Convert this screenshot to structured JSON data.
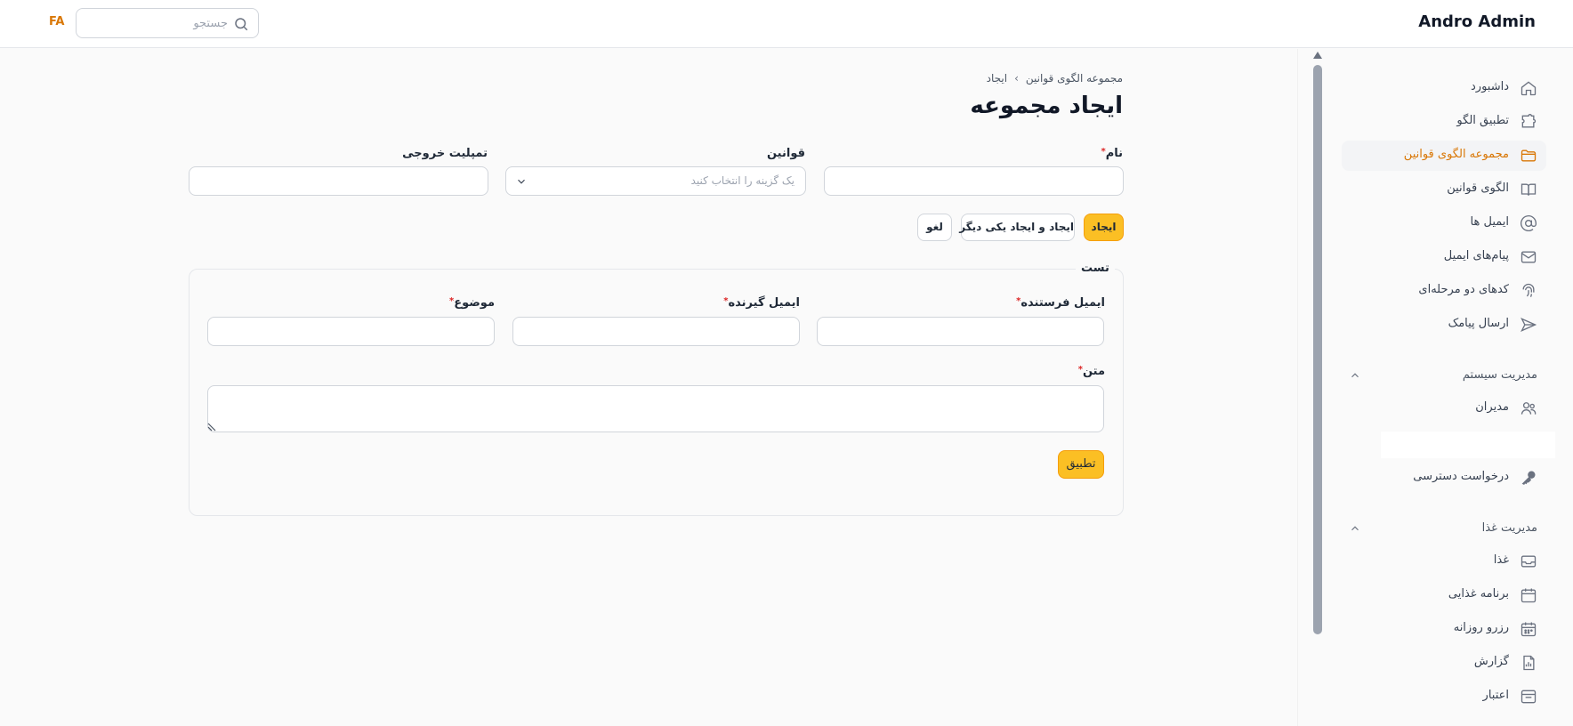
{
  "header": {
    "brand": "Andro Admin",
    "search_placeholder": "جستجو",
    "lang": "FA"
  },
  "sidebar": {
    "items": [
      {
        "label": "داشبورد",
        "icon": "home-icon"
      },
      {
        "label": "تطبیق الگو",
        "icon": "puzzle-icon"
      },
      {
        "label": "مجموعه الگوی قوانین",
        "icon": "folder-icon",
        "active": true
      },
      {
        "label": "الگوی قوانین",
        "icon": "book-icon"
      },
      {
        "label": "ایمیل ها",
        "icon": "at-sign-icon"
      },
      {
        "label": "پیام‌های ایمیل",
        "icon": "envelope-icon"
      },
      {
        "label": "کدهای دو مرحله‌ای",
        "icon": "fingerprint-icon"
      },
      {
        "label": "ارسال پیامک",
        "icon": "send-icon"
      }
    ],
    "groups": [
      {
        "label": "مدیریت سیستم",
        "items": [
          {
            "label": "مدیران",
            "icon": "users-icon"
          }
        ]
      },
      {
        "label": "",
        "items": [
          {
            "label": "درخواست دسترسی",
            "icon": "key-icon"
          }
        ]
      },
      {
        "label": "مدیریت غذا",
        "items": [
          {
            "label": "غذا",
            "icon": "inbox-icon"
          },
          {
            "label": "برنامه غذایی",
            "icon": "calendar-icon"
          },
          {
            "label": "رزرو روزانه",
            "icon": "calendar-grid-icon"
          },
          {
            "label": "گزارش",
            "icon": "report-icon"
          },
          {
            "label": "اعتبار",
            "icon": "archive-icon"
          }
        ]
      }
    ]
  },
  "breadcrumb": {
    "parent": "مجموعه الگوی قوانین",
    "separator": "›",
    "current": "ایجاد"
  },
  "page_title": "ایجاد مجموعه",
  "form": {
    "name_label": "نام",
    "rules_label": "قوانین",
    "rules_placeholder": "یک گزینه را انتخاب کنید",
    "template_label": "تمپلیت خروجی",
    "required_mark": "*"
  },
  "actions": {
    "create": "ایجاد",
    "create_another": "ایجاد و ایجاد یکی دیگر",
    "cancel": "لغو"
  },
  "test": {
    "legend": "تست",
    "sender_label": "ایمیل فرستنده",
    "recipient_label": "ایمیل گیرنده",
    "subject_label": "موضوع",
    "body_label": "متن",
    "apply": "تطبیق"
  }
}
